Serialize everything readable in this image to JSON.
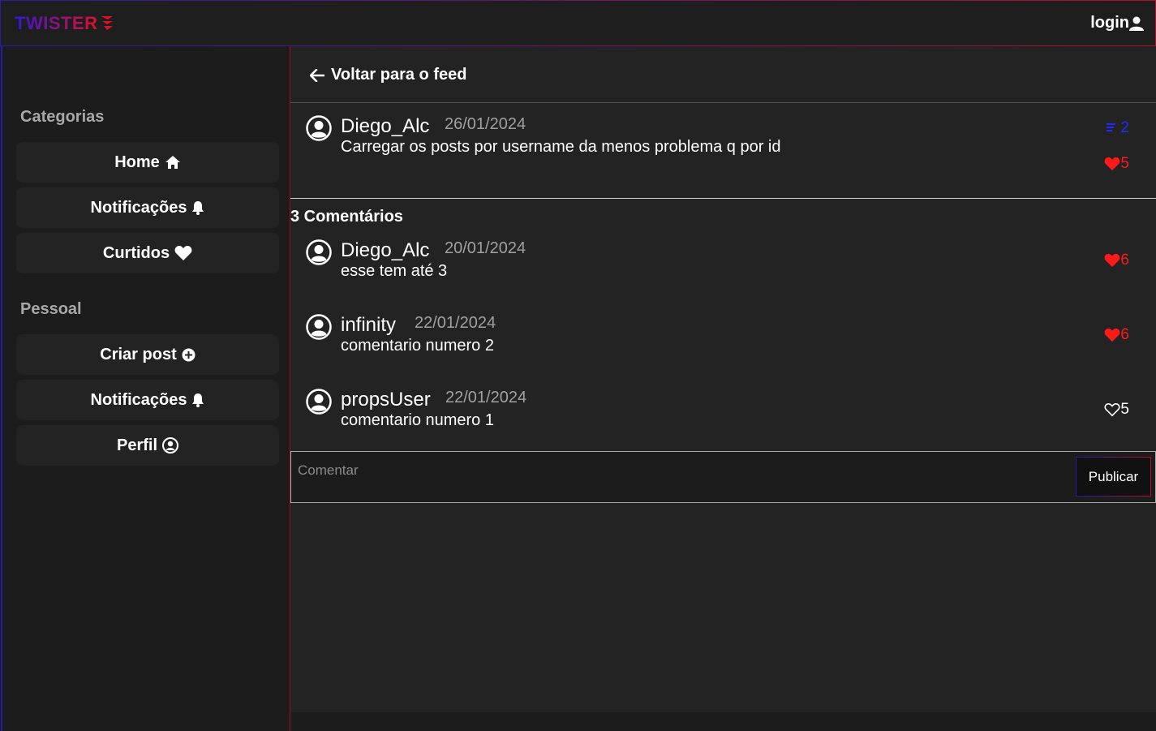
{
  "app": {
    "logo_text": "TWISTER"
  },
  "header": {
    "login_label": "login"
  },
  "sidebar": {
    "categories_title": "Categorias",
    "categories": [
      {
        "label": "Home",
        "icon": "home-icon"
      },
      {
        "label": "Notificações",
        "icon": "bell-icon"
      },
      {
        "label": "Curtidos",
        "icon": "heart-icon"
      }
    ],
    "personal_title": "Pessoal",
    "personal": [
      {
        "label": "Criar post",
        "icon": "plus-circle-icon"
      },
      {
        "label": "Notificações",
        "icon": "bell-icon"
      },
      {
        "label": "Perfil",
        "icon": "user-circle-icon"
      }
    ]
  },
  "main": {
    "back_label": "Voltar para o feed",
    "post": {
      "username": "Diego_Alc",
      "date": "26/01/2024",
      "text": "Carregar os posts por username da menos problema q por id",
      "comment_count": "2",
      "likes": "5",
      "liked": true
    },
    "comments_title": "3 Comentários",
    "comments": [
      {
        "username": "Diego_Alc",
        "date": "20/01/2024",
        "text": "esse tem até 3",
        "likes": "6",
        "liked": true
      },
      {
        "username": "infinity",
        "date": "22/01/2024",
        "text": "comentario numero 2",
        "likes": "6",
        "liked": true
      },
      {
        "username": "propsUser",
        "date": "22/01/2024",
        "text": "comentario numero 1",
        "likes": "5",
        "liked": false
      }
    ],
    "comment_form": {
      "placeholder": "Comentar",
      "publish_label": "Publicar"
    }
  },
  "colors": {
    "accent_blue": "#2a1aa8",
    "accent_red": "#b0102a",
    "like_red": "#ff1a1a",
    "comment_blue": "#1e2cff"
  }
}
